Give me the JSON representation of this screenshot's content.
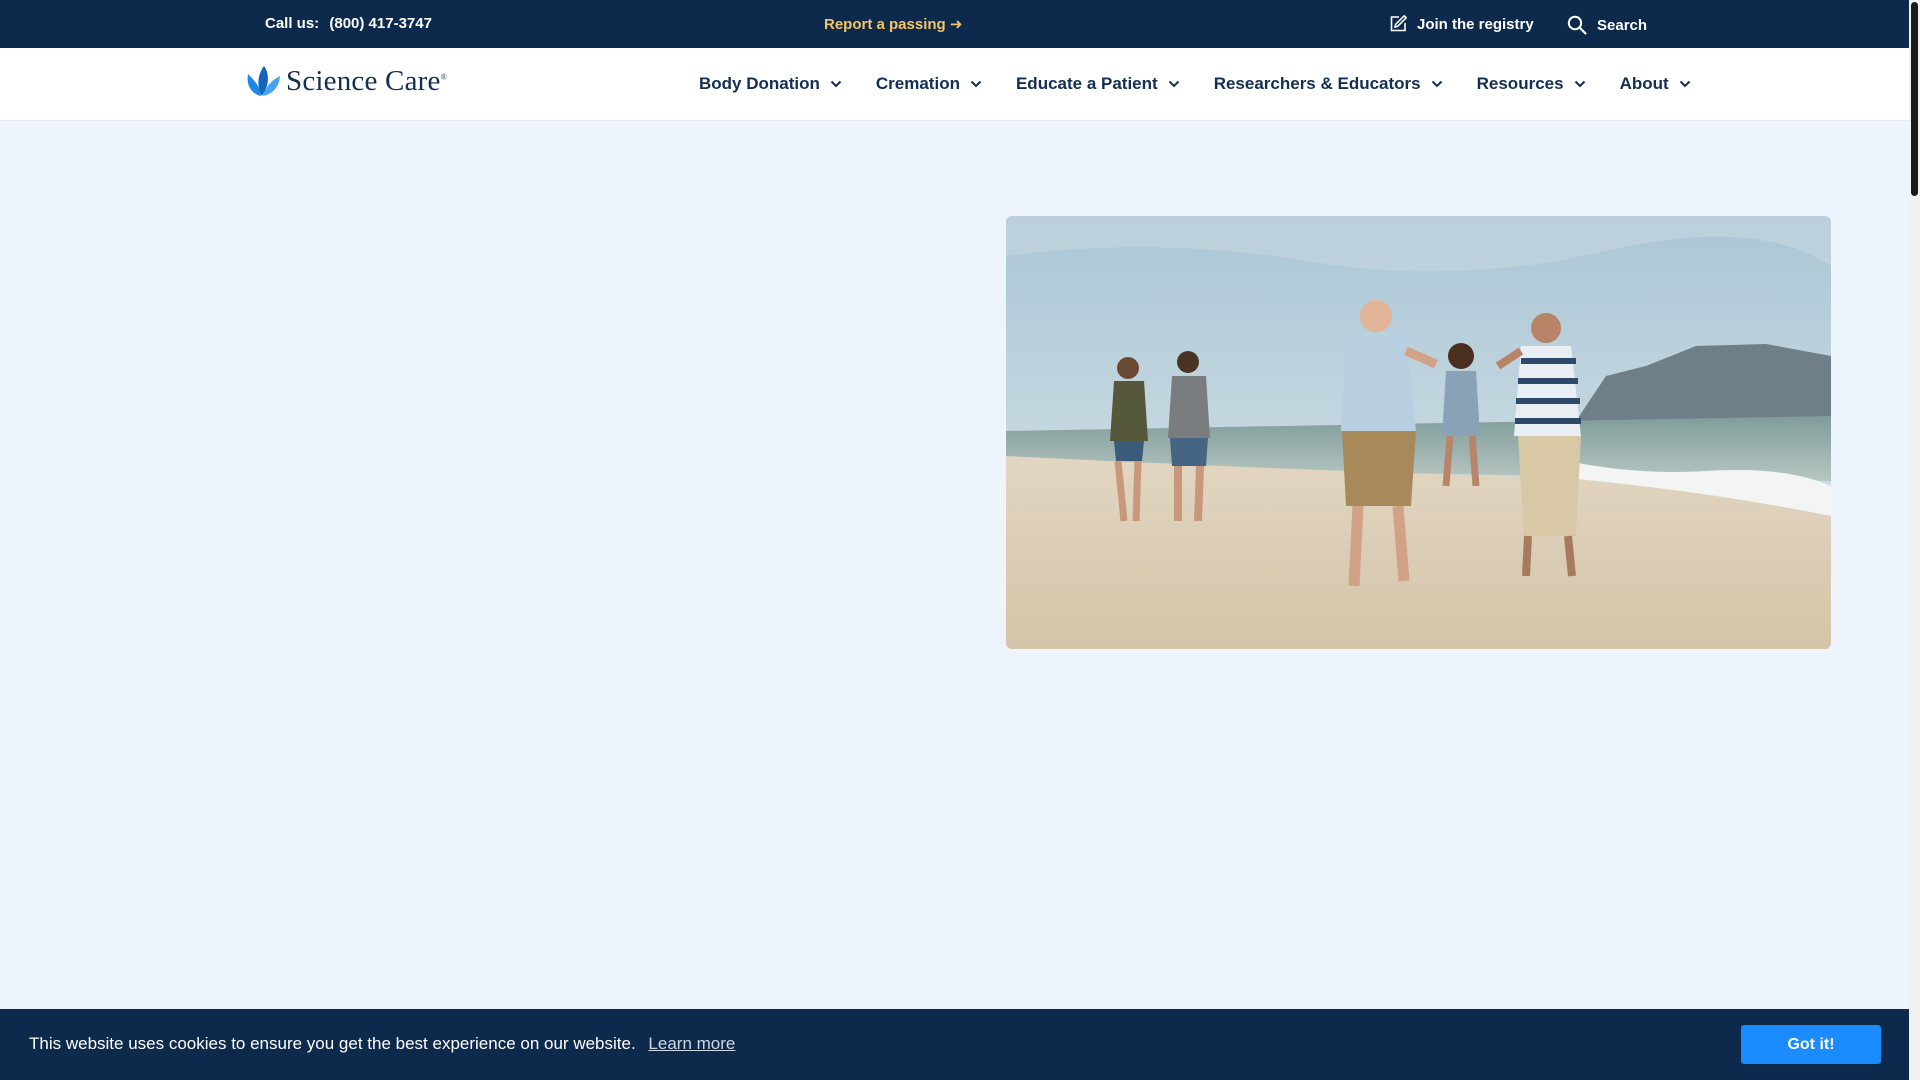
{
  "utility_bar": {
    "call_label": "Call us:",
    "phone": "(800) 417-3747",
    "report_link": "Report a passing ➜",
    "join_registry": "Join the registry",
    "search": "Search"
  },
  "brand": {
    "name": "Science Care",
    "trademark": "®",
    "primary_color": "#1e88e5",
    "navy": "#0d2a4d"
  },
  "nav": {
    "items": [
      {
        "label": "Body Donation"
      },
      {
        "label": "Cremation"
      },
      {
        "label": "Educate a Patient"
      },
      {
        "label": "Researchers & Educators"
      },
      {
        "label": "Resources"
      },
      {
        "label": "About"
      }
    ]
  },
  "hero": {
    "image": "family-walking-on-beach-photo"
  },
  "cookie_banner": {
    "message": "This website uses cookies to ensure you get the best experience on our website.",
    "learn_more": "Learn more",
    "accept": "Got it!",
    "accent": "#1a8cff"
  }
}
